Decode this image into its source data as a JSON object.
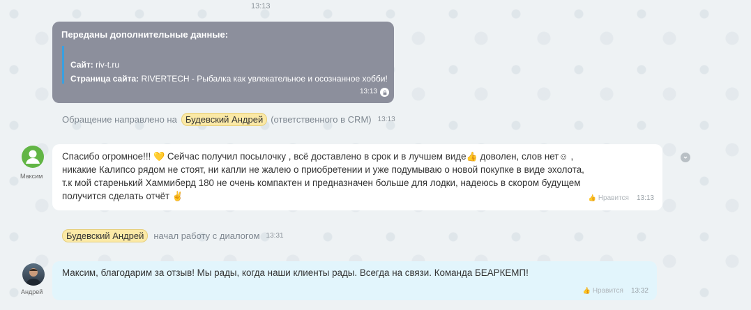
{
  "chat": {
    "top_time": "13:13",
    "system_message": {
      "title": "Переданы дополнительные данные:",
      "site_label": "Сайт:",
      "site_value": "riv-t.ru",
      "page_label": "Страница сайта:",
      "page_value": "RIVERTECH - Рыбалка как увлекательное и осознанное хобби!",
      "time": "13:13"
    },
    "notice_1": {
      "prefix": "Обращение направлено на",
      "person": "Будевский Андрей",
      "suffix": "(ответственного в CRM)",
      "time": "13:13"
    },
    "message_in": {
      "author": "Максим",
      "text_1": "Спасибо огромное!!!",
      "text_2": "Сейчас получил посылочку , всё доставлено в срок и в лучшем виде",
      "text_3": "доволен, слов нет",
      "text_4": ",",
      "text_5": "никакие Калипсо рядом не стоят, ни капли не жалею о приобретении и уже подумываю о новой покупке в виде эхолота,",
      "text_6": "т.к мой старенький Хаммиберд 180 не очень компактен и предназначен больше для лодки, надеюсь в скором будущем",
      "text_7": "получится сделать отчёт",
      "emoji_heart": "💛",
      "emoji_thumb": "👍",
      "emoji_smile": "☺",
      "emoji_hand": "✌",
      "like_label": "Нравится",
      "time": "13:13"
    },
    "notice_2": {
      "person": "Будевский Андрей",
      "text": "начал работу с диалогом",
      "time": "13:31"
    },
    "message_out": {
      "author": "Андрей",
      "text": "Максим, благодарим за отзыв! Мы рады, когда наши клиенты рады. Всегда на связи. Команда БЕАРКЕМП!",
      "like_label": "Нравится",
      "time": "13:32"
    }
  }
}
